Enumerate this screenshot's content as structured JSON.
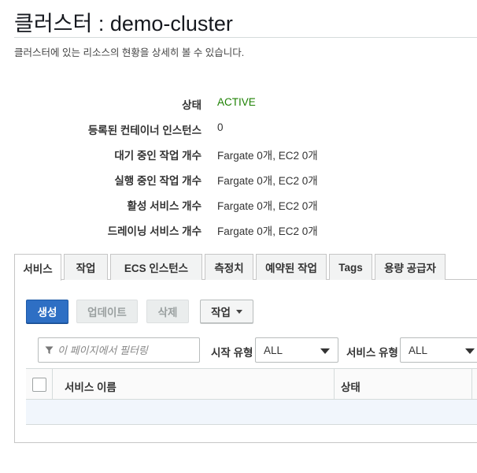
{
  "header": {
    "title": "클러스터 : demo-cluster",
    "subtitle": "클러스터에 있는 리소스의 현황을 상세히 볼 수 있습니다."
  },
  "details": [
    {
      "label": "상태",
      "value": "ACTIVE"
    },
    {
      "label": "등록된 컨테이너 인스턴스",
      "value": "0"
    },
    {
      "label": "대기 중인 작업 개수",
      "value": "Fargate 0개, EC2 0개"
    },
    {
      "label": "실행 중인 작업 개수",
      "value": "Fargate 0개, EC2 0개"
    },
    {
      "label": "활성 서비스 개수",
      "value": "Fargate 0개, EC2 0개"
    },
    {
      "label": "드레이닝 서비스 개수",
      "value": "Fargate 0개, EC2 0개"
    }
  ],
  "tabs": [
    {
      "label": "서비스",
      "active": true
    },
    {
      "label": "작업"
    },
    {
      "label": "ECS 인스턴스"
    },
    {
      "label": "측정치"
    },
    {
      "label": "예약된 작업"
    },
    {
      "label": "Tags"
    },
    {
      "label": "용량 공급자"
    }
  ],
  "toolbar": {
    "create_label": "생성",
    "update_label": "업데이트",
    "delete_label": "삭제",
    "actions_label": "작업"
  },
  "filter": {
    "placeholder": "이 페이지에서 필터링",
    "launch_type_label": "시작 유형",
    "launch_type_value": "ALL",
    "service_type_label": "서비스 유형",
    "service_type_value": "ALL"
  },
  "table": {
    "columns": [
      "서비스 이름",
      "상태"
    ]
  },
  "colors": {
    "accent": "#2e6fc4",
    "status_active": "#1d8102"
  }
}
